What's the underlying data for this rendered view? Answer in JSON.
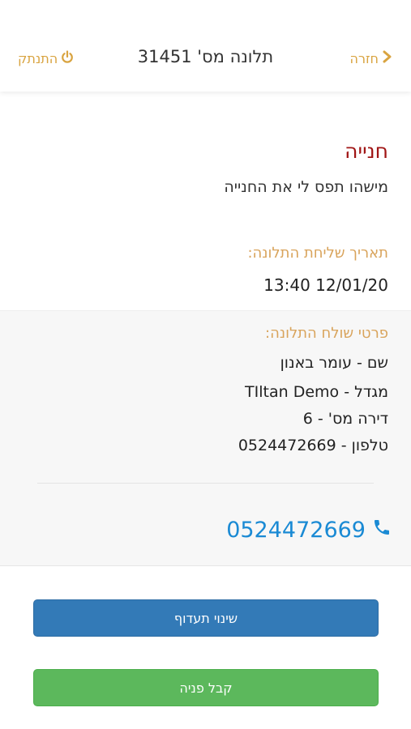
{
  "header": {
    "back_label": "חזרה",
    "title": "תלונה מס' 31451",
    "logout_label": "התנתק"
  },
  "complaint": {
    "title": "חנייה",
    "description": "מישהו תפס לי את החנייה"
  },
  "date": {
    "label": "תאריך שליחת התלונה:",
    "value": "13:40 12/01/20"
  },
  "sender": {
    "label": "פרטי שולח התלונה:",
    "name_line": "שם - עומר באנון",
    "building_line": "מגדל - TIltan Demo",
    "apartment_line": "דירה מס' - 6",
    "phone_line": "טלפון - 0524472669"
  },
  "phone": {
    "number": "0524472669"
  },
  "actions": {
    "change_priority": "שינוי תעדוף",
    "accept": "קבל פניה"
  },
  "colors": {
    "accent": "#d9a441",
    "complaint_title": "#a01515",
    "link": "#1a8ad4",
    "primary_button": "#337ab7",
    "success_button": "#5cb85c"
  },
  "icons": {
    "back": "chevron-right-icon",
    "logout": "power-icon",
    "phone": "phone-icon"
  }
}
